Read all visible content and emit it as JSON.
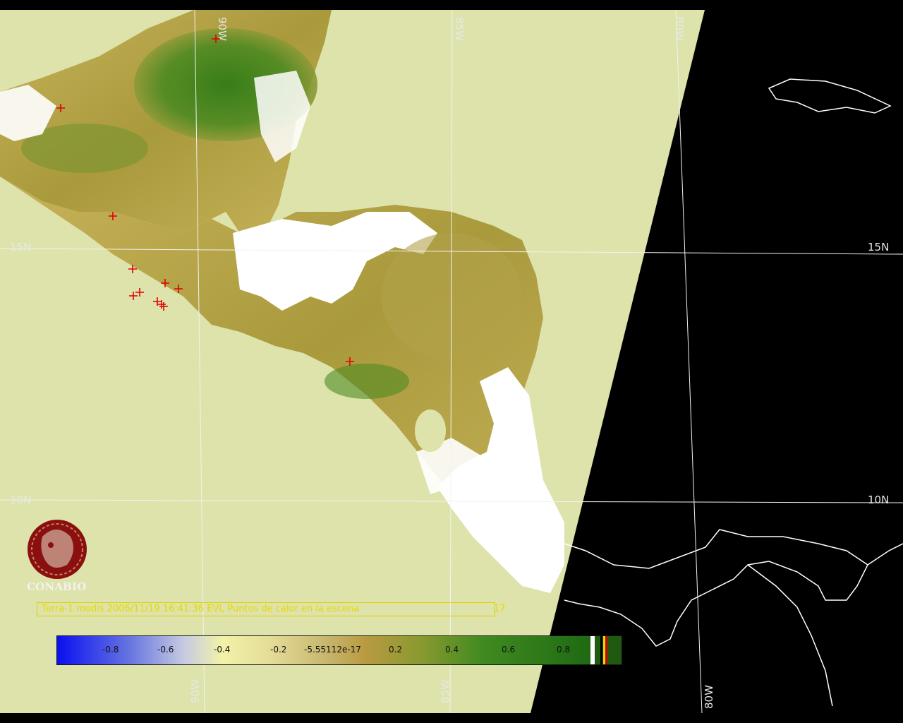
{
  "grid_labels": {
    "lat_15n_left": "15N",
    "lat_15n_right": "15N",
    "lat_10n_left": "10N",
    "lat_10n_right": "10N",
    "lon_90w_top": "90W",
    "lon_85w_top": "85W",
    "lon_80w_top": "80W",
    "lon_90w_bottom": "90W",
    "lon_85w_bottom": "85W",
    "lon_80w_bottom": "80W"
  },
  "logo": {
    "name": "CONABIO",
    "icon": "conabio-macaw-logo"
  },
  "caption": {
    "text": "Terra-1 modis 2006/11/19 16:41:36 EVI, Puntos de calor en la escena",
    "count": "17"
  },
  "colorbar": {
    "ticks": [
      "-0.8",
      "-0.6",
      "-0.4",
      "-0.2",
      "-5.55112e-17",
      "0.2",
      "0.4",
      "0.6",
      "0.8"
    ]
  },
  "colors": {
    "ocean": "#dde3ab",
    "no_data": "#000000",
    "cloud": "#ffffff",
    "hotspot": "#e00000",
    "grid": "#f0f0f0",
    "caption": "#e8d800",
    "logo": "#8a1010"
  },
  "hotspot_marker": "red-cross"
}
